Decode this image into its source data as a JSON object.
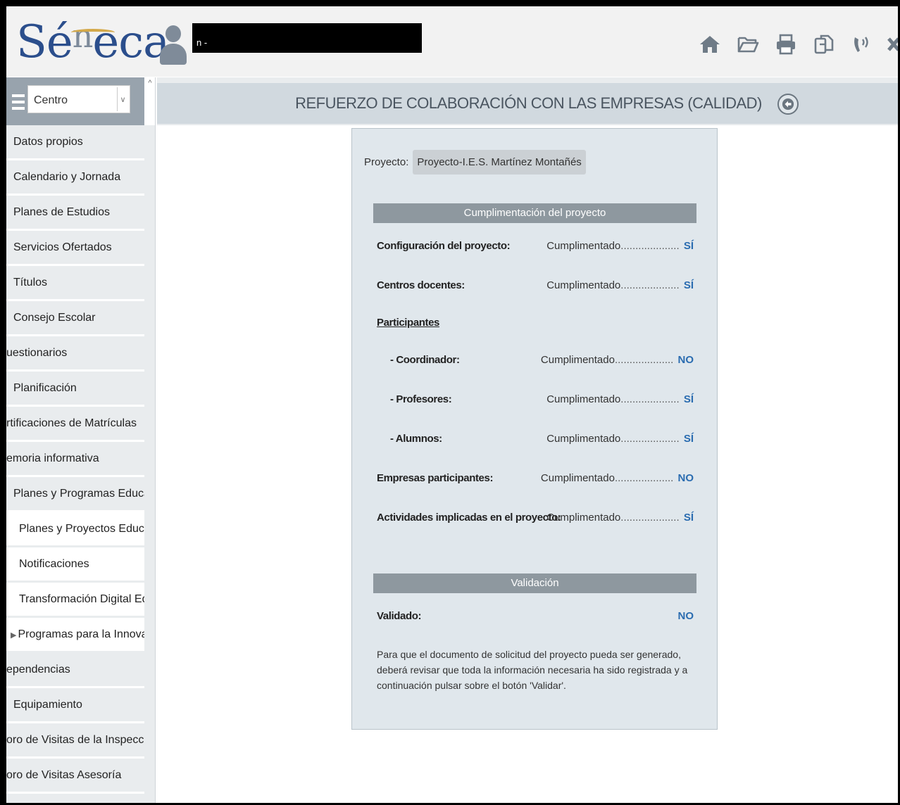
{
  "header": {
    "logo": {
      "se": "Sé",
      "n": "n",
      "eca": "eca"
    },
    "user_name_visible": "n -",
    "tools": [
      {
        "icon": "home-icon",
        "label": "Inicio"
      },
      {
        "icon": "folder-open-icon",
        "label": "Abrir"
      },
      {
        "icon": "print-icon",
        "label": "Imprimir"
      },
      {
        "icon": "copy-icon",
        "label": "Copiar"
      },
      {
        "icon": "contact-icon",
        "label": "Contacto"
      },
      {
        "icon": "close-icon",
        "label": "Salir"
      }
    ]
  },
  "sidebar": {
    "selector": {
      "value": "Centro"
    },
    "items": [
      {
        "label": "Datos propios"
      },
      {
        "label": "Calendario y Jornada"
      },
      {
        "label": "Planes de Estudios"
      },
      {
        "label": "Servicios Ofertados"
      },
      {
        "label": "Títulos"
      },
      {
        "label": "Consejo Escolar"
      },
      {
        "label": "uestionarios"
      },
      {
        "label": "Planificación"
      },
      {
        "label": "rtificaciones de Matrículas"
      },
      {
        "label": "emoria informativa"
      },
      {
        "label": "Planes y Programas Educativos"
      },
      {
        "label": "Planes y Proyectos Educativos"
      },
      {
        "label": "Notificaciones"
      },
      {
        "label": "Transformación Digital Educat"
      },
      {
        "label": "Programas para la Innovación"
      },
      {
        "label": "ependencias"
      },
      {
        "label": "Equipamiento"
      },
      {
        "label": "oro de Visitas de la Inspección"
      },
      {
        "label": "oro de Visitas Asesoría"
      }
    ]
  },
  "main": {
    "title": "REFUERZO DE COLABORACIÓN CON LAS EMPRESAS (CALIDAD)",
    "proyecto_label": "Proyecto:",
    "proyecto_value": "Proyecto-I.E.S. Martínez Montañés",
    "section1_title": "Cumplimentación del proyecto",
    "rows": [
      {
        "label": "Configuración del proyecto:",
        "status": "Cumplimentado",
        "dots": "....................",
        "value": "SÍ"
      },
      {
        "label": "Centros docentes:",
        "status": "Cumplimentado",
        "dots": "....................",
        "value": "SÍ"
      },
      {
        "label": "Participantes"
      },
      {
        "label": "- Coordinador:",
        "status": "Cumplimentado",
        "dots": "....................",
        "value": "NO"
      },
      {
        "label": "- Profesores:",
        "status": "Cumplimentado",
        "dots": "....................",
        "value": "SÍ"
      },
      {
        "label": "- Alumnos:",
        "status": "Cumplimentado",
        "dots": "....................",
        "value": "SÍ"
      },
      {
        "label": "Empresas participantes:",
        "status": "Cumplimentado",
        "dots": "....................",
        "value": "NO"
      },
      {
        "label": "Actividades implicadas en el proyecto:",
        "status": "Cumplimentado",
        "dots": "....................",
        "value": "SÍ"
      }
    ],
    "section2_title": "Validación",
    "validado_label": "Validado:",
    "validado_value": "NO",
    "note": "Para que el documento de solicitud del proyecto pueda ser generado, deberá revisar que toda la información necesaria ha sido registrada y a continuación pulsar sobre el botón 'Validar'."
  }
}
